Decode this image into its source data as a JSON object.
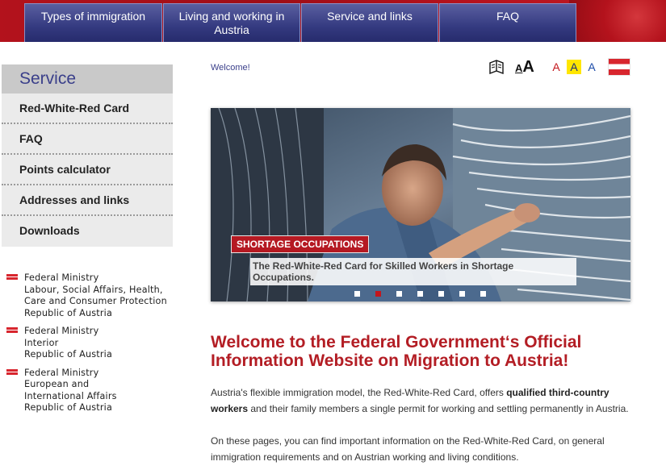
{
  "nav": {
    "items": [
      {
        "label": "Types of immigration"
      },
      {
        "label": "Living and working in Austria"
      },
      {
        "label": "Service and links"
      },
      {
        "label": "FAQ"
      }
    ]
  },
  "sidebar": {
    "title": "Service",
    "items": [
      {
        "label": "Red-White-Red Card"
      },
      {
        "label": "FAQ"
      },
      {
        "label": "Points calculator"
      },
      {
        "label": "Addresses and links"
      },
      {
        "label": "Downloads"
      }
    ],
    "ministries": [
      {
        "lines": [
          "Federal Ministry",
          "Labour, Social Affairs, Health,",
          "Care and Consumer Protection",
          "Republic of Austria"
        ]
      },
      {
        "lines": [
          "Federal Ministry",
          "Interior",
          "Republic of Austria"
        ]
      },
      {
        "lines": [
          "Federal Ministry",
          "European and",
          "International Affairs",
          "Republic of Austria"
        ]
      }
    ]
  },
  "header": {
    "welcome_link": "Welcome!",
    "tools": {
      "read_icon": "book-reader-icon",
      "font_size_small": "A",
      "font_size_big": "A",
      "contrast_1": "A",
      "contrast_2": "A",
      "contrast_3": "A",
      "language_flag": "austrian-flag-icon"
    }
  },
  "hero": {
    "tag": "SHORTAGE OCCUPATIONS",
    "caption": "The Red-White-Red Card for Skilled Workers in Shortage Occupations.",
    "slides_total": 7,
    "active_slide": 2
  },
  "main": {
    "headline": "Welcome to the Federal Government‘s Official Information Website on Migration to Austria!",
    "p1_a": "Austria's flexible immigration model, the Red-White-Red Card, offers ",
    "p1_b": "qualified third-country workers",
    "p1_c": " and their family members a single permit for working and settling permanently in Austria.",
    "p2": "On these pages, you can find important information on the Red-White-Red Card, on general immigration requirements and on Austrian working and living conditions."
  },
  "colors": {
    "brand_red": "#b31d24",
    "nav_blue": "#343a80",
    "sidebar_gray": "#ebebeb"
  }
}
